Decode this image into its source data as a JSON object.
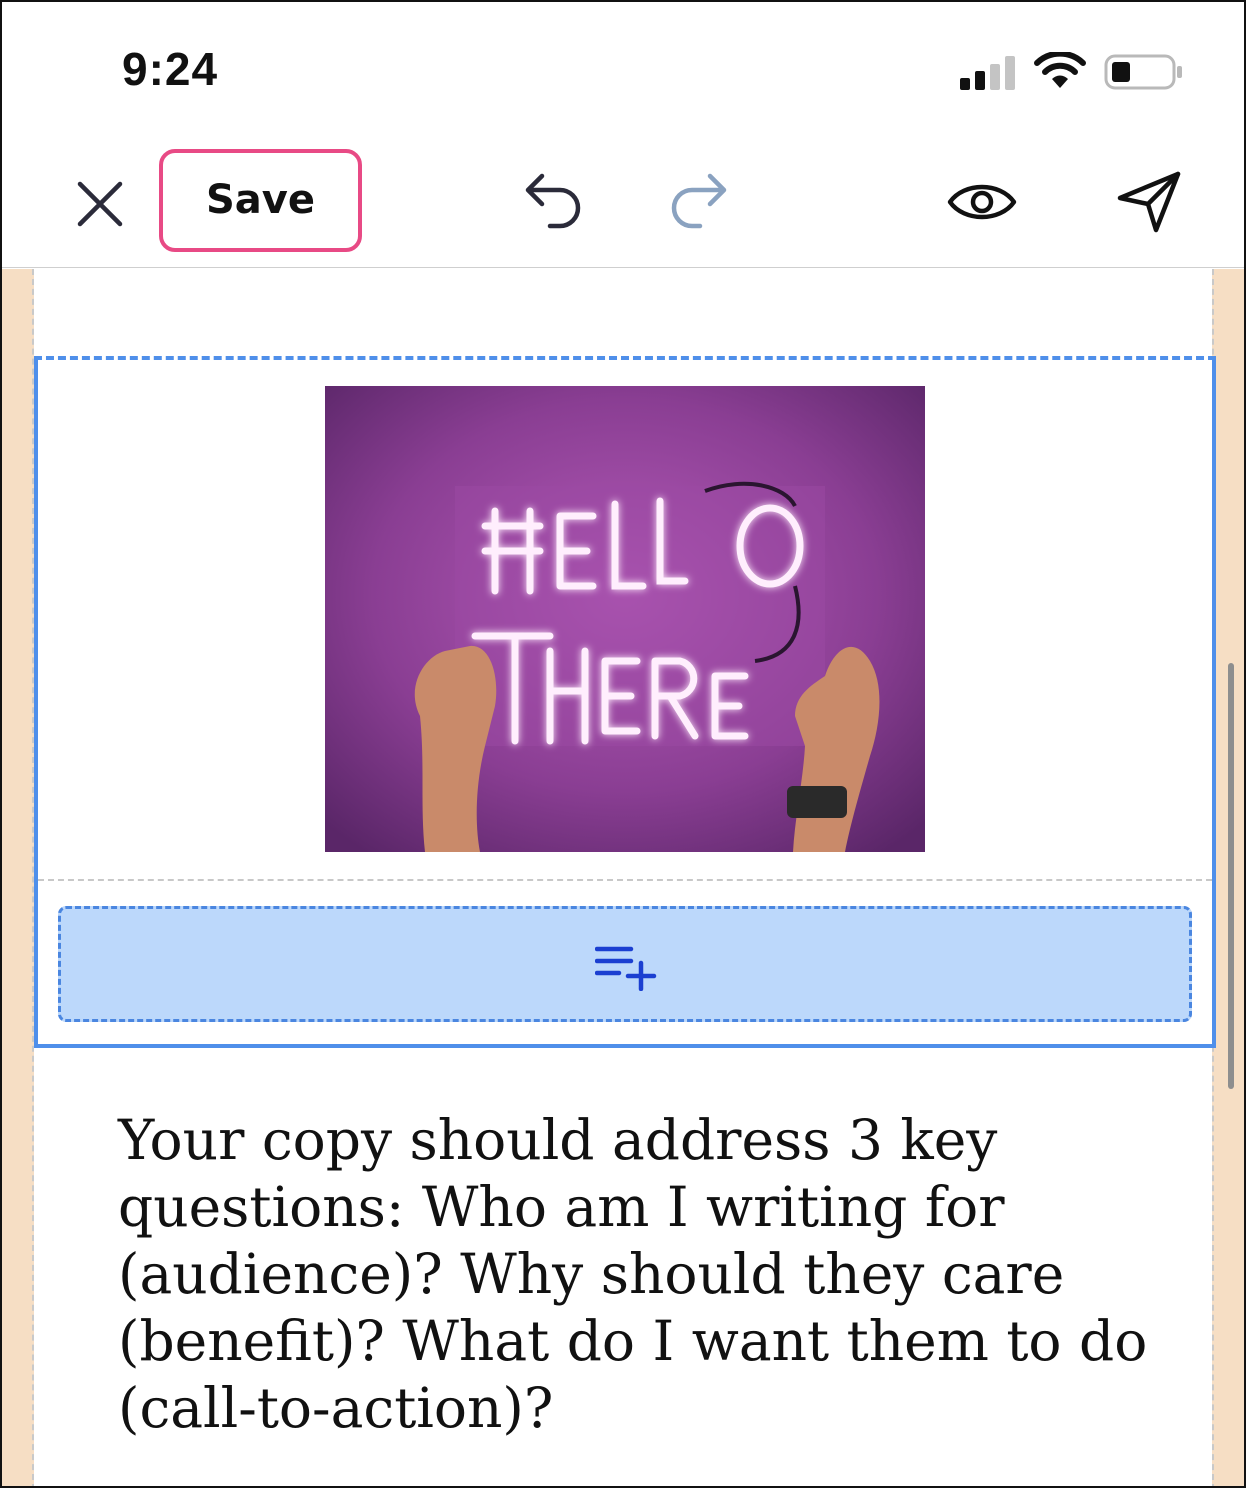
{
  "status_bar": {
    "time": "9:24"
  },
  "toolbar": {
    "save_label": "Save",
    "icons": [
      "close-icon",
      "undo-icon",
      "redo-icon",
      "eye-icon",
      "send-icon"
    ]
  },
  "editor": {
    "image_block": {
      "image_text": "HELLO THERE",
      "add_row_icon": "add-row-icon"
    },
    "text_block": {
      "content": "Your copy should address 3 key questions: Who am I writing for (audience)? Why should they care (benefit)? What do I want them to do (call-to-action)?"
    }
  },
  "colors": {
    "save_border": "#e84a85",
    "selection_blue": "#4f8fea",
    "add_row_fill": "#bcd8fb",
    "gutter": "#f6dec4",
    "photo_purple": "#8a3e93"
  }
}
